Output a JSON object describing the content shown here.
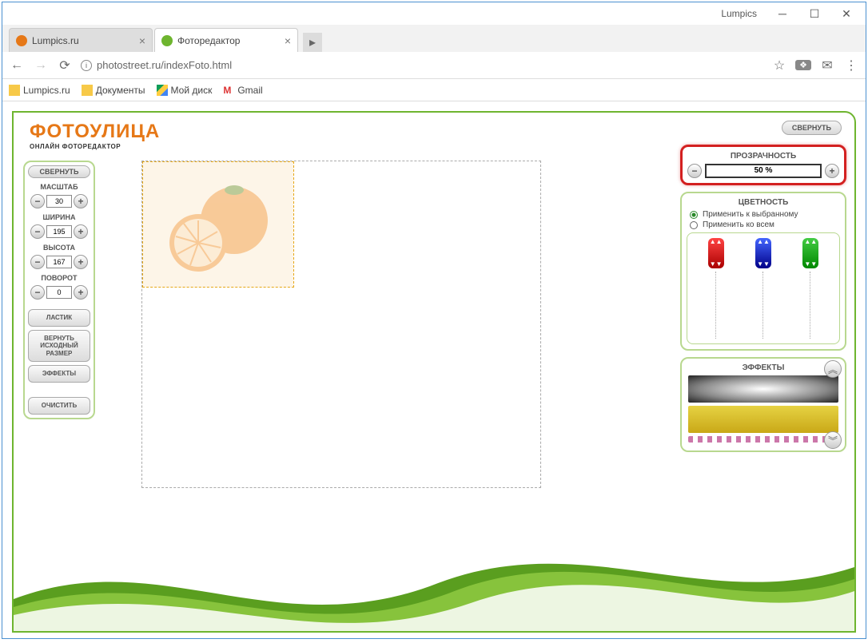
{
  "window": {
    "title": "Lumpics"
  },
  "browser": {
    "tabs": [
      {
        "title": "Lumpics.ru",
        "favicon_color": "#e67817"
      },
      {
        "title": "Фоторедактор",
        "favicon_color": "#6eb52f"
      }
    ],
    "url": "photostreet.ru/indexFoto.html",
    "bookmarks": [
      {
        "label": "Lumpics.ru"
      },
      {
        "label": "Документы"
      },
      {
        "label": "Мой диск"
      },
      {
        "label": "Gmail"
      }
    ]
  },
  "app": {
    "logo_main": "ФОТОУЛИЦА",
    "logo_sub": "ОНЛАЙН ФОТОРЕДАКТОР",
    "left": {
      "collapse": "СВЕРНУТЬ",
      "scale_label": "МАСШТАБ",
      "scale_value": "30",
      "width_label": "ШИРИНА",
      "width_value": "195",
      "height_label": "ВЫСОТА",
      "height_value": "167",
      "rotate_label": "ПОВОРОТ",
      "rotate_value": "0",
      "eraser": "ЛАСТИК",
      "restore": "ВЕРНУТЬ ИСХОДНЫЙ РАЗМЕР",
      "effects": "ЭФФЕКТЫ",
      "clear": "ОЧИСТИТЬ"
    },
    "right": {
      "collapse_top": "СВЕРНУТЬ",
      "opacity_label": "ПРОЗРАЧНОСТЬ",
      "opacity_value": "50 %",
      "color_label": "ЦВЕТНОСТЬ",
      "apply_selected": "Применить к выбранному",
      "apply_all": "Применить ко всем",
      "effects_label": "ЭФФЕКТЫ"
    }
  }
}
